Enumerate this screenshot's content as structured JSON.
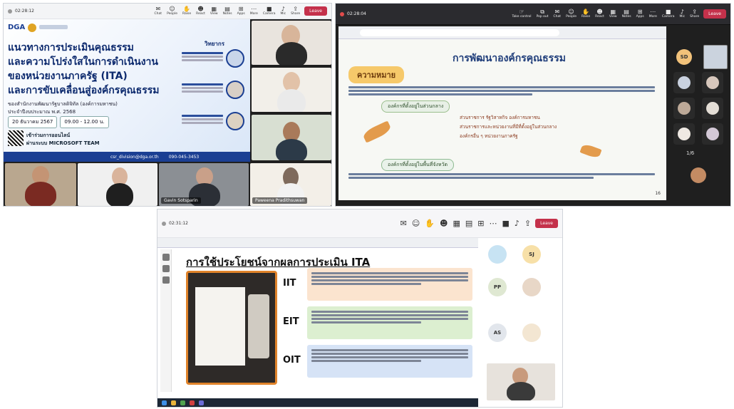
{
  "w1": {
    "time": "02:28:12",
    "tools": [
      {
        "icon": "chat-icon",
        "label": "Chat"
      },
      {
        "icon": "people-icon",
        "label": "People"
      },
      {
        "icon": "raise-icon",
        "label": "Raise"
      },
      {
        "icon": "react-icon",
        "label": "React"
      },
      {
        "icon": "view-icon",
        "label": "View"
      },
      {
        "icon": "notes-icon",
        "label": "Notes"
      },
      {
        "icon": "apps-icon",
        "label": "Apps"
      },
      {
        "icon": "more-icon",
        "label": "More"
      },
      {
        "icon": "camera-icon",
        "label": "Camera"
      },
      {
        "icon": "mic-icon",
        "label": "Mic"
      },
      {
        "icon": "share-icon",
        "label": "Share"
      }
    ],
    "leave": "Leave",
    "slide": {
      "brand": "DGA",
      "title1": "แนวทางการประเมินคุณธรรม",
      "title2": "และความโปร่งใสในการดำเนินงาน",
      "title3": "ของหน่วยงานภาครัฐ (ITA)",
      "title4": "และการขับเคลื่อนสู่องค์กรคุณธรรม",
      "org1": "ของสำนักงานพัฒนารัฐบาลดิจิทัล (องค์การมหาชน)",
      "org2": "ประจำปีงบประมาณ พ.ศ. 2568",
      "date": "20 ธันวาคม 2567",
      "time": "09.00 - 12.00 น.",
      "join1": "เข้าร่วมการออนไลน์",
      "join2": "ผ่านระบบ MICROSOFT TEAM",
      "speakers_heading": "วิทยากร",
      "footer_email": "csr_division@dga.or.th",
      "footer_phone": "090-045-3453"
    },
    "names": [
      "Gavin Sotsparin",
      "Paweena Pradithsuwan"
    ]
  },
  "w2": {
    "time": "02:28:04",
    "tools": [
      {
        "icon": "take-control-icon",
        "label": "Take control"
      },
      {
        "icon": "pop-out-icon",
        "label": "Pop out"
      },
      {
        "icon": "chat-icon",
        "label": "Chat"
      },
      {
        "icon": "people-icon",
        "label": "People"
      },
      {
        "icon": "raise-icon",
        "label": "Raise"
      },
      {
        "icon": "react-icon",
        "label": "React"
      },
      {
        "icon": "view-icon",
        "label": "View"
      },
      {
        "icon": "notes-icon",
        "label": "Notes"
      },
      {
        "icon": "apps-icon",
        "label": "Apps"
      },
      {
        "icon": "more-icon",
        "label": "More"
      },
      {
        "icon": "camera-icon",
        "label": "Camera"
      },
      {
        "icon": "mic-icon",
        "label": "Mic"
      },
      {
        "icon": "share-icon",
        "label": "Share"
      }
    ],
    "leave": "Leave",
    "slide": {
      "title": "การพัฒนาองค์กรคุณธรรม",
      "tag": "ความหมาย",
      "sub1": "องค์กรที่ตั้งอยู่ในส่วนกลาง",
      "items": [
        "ส่วนราชการ รัฐวิสาหกิจ องค์การมหาชน",
        "ส่วนราชการและหน่วยงานที่มีที่ตั้งอยู่ในส่วนกลาง",
        "องค์กรอื่น ๆ หน่วยงานภาครัฐ"
      ],
      "sub2": "องค์กรที่ตั้งอยู่ในพื้นที่จังหวัด",
      "page": "16"
    },
    "avatar": "SD",
    "pager": "1/6"
  },
  "w3": {
    "time": "02:31:12",
    "leave": "Leave",
    "slide": {
      "title": "การใช้ประโยชน์จากผลการประเมิน ITA",
      "rows": [
        {
          "label": "IIT",
          "color": "#fbe4cf"
        },
        {
          "label": "EIT",
          "color": "#dcefd0"
        },
        {
          "label": "OIT",
          "color": "#d6e3f6"
        }
      ]
    },
    "avatars": [
      "SJ",
      "PP",
      "AS"
    ]
  }
}
